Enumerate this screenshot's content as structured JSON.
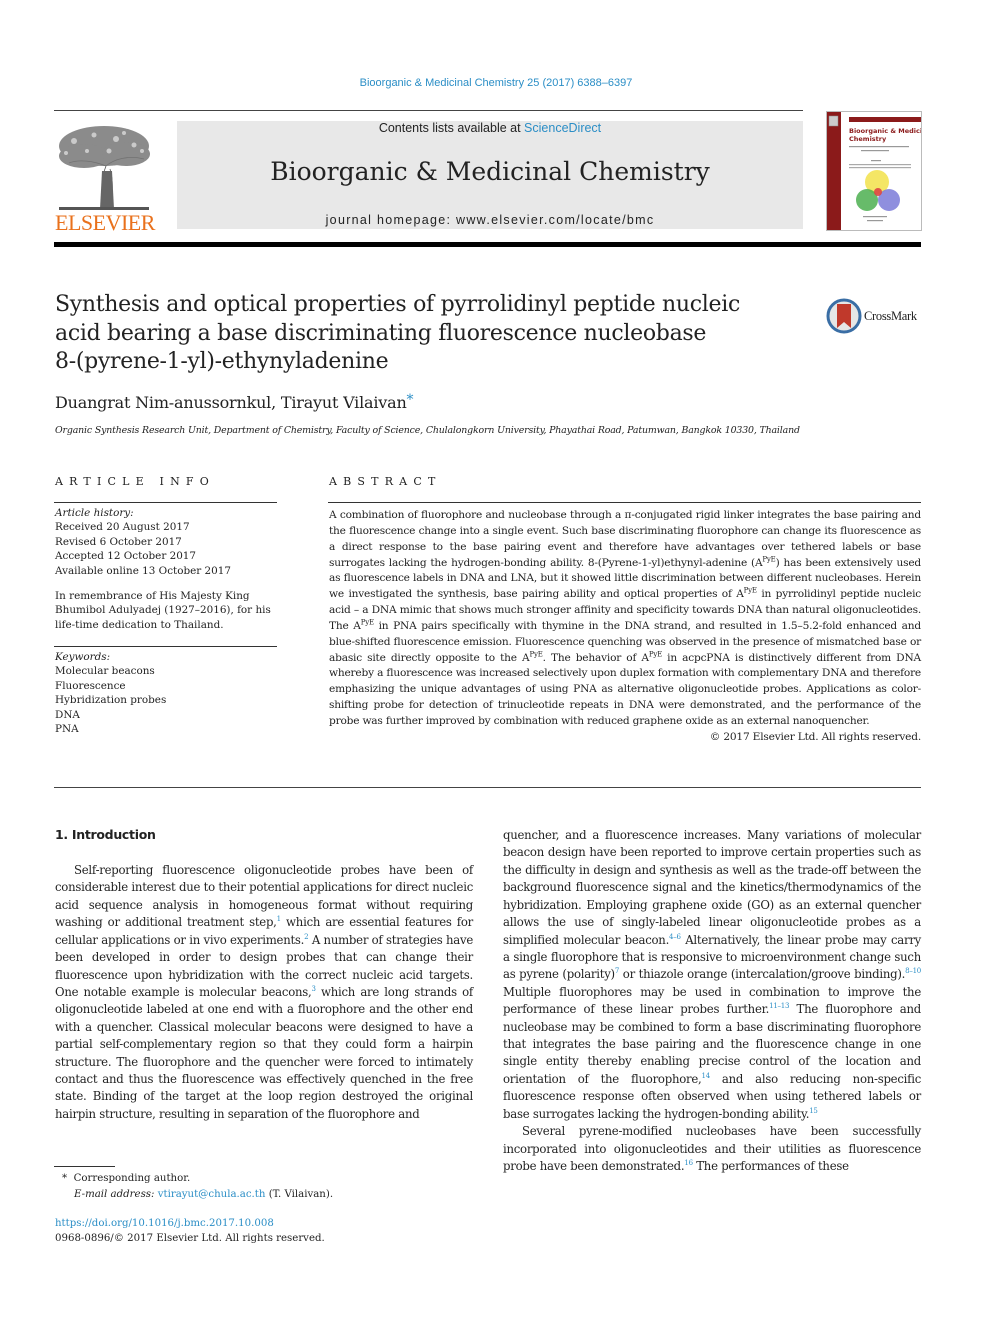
{
  "header": {
    "citation": "Bioorganic & Medicinal Chemistry 25 (2017) 6388–6397",
    "contents_prefix": "Contents lists available at ",
    "contents_link": "ScienceDirect",
    "journal_title": "Bioorganic & Medicinal Chemistry",
    "homepage": "journal homepage: www.elsevier.com/locate/bmc",
    "publisher_logo_text": "ELSEVIER",
    "cover_title": "Bioorganic & Medicinal Chemistry",
    "crossmark_label": "CrossMark"
  },
  "colors": {
    "link": "#2b8ec6",
    "elsevier_orange": "#e9711c",
    "cover_red": "#8b1a1a"
  },
  "article": {
    "title_lines": [
      "Synthesis and optical properties of pyrrolidinyl peptide nucleic",
      "acid bearing a base discriminating fluorescence nucleobase",
      "8-(pyrene-1-yl)-ethynyladenine"
    ],
    "authors": "Duangrat Nim-anussornkul, Tirayut Vilaivan",
    "corresponding_mark": "*",
    "affiliation": "Organic Synthesis Research Unit, Department of Chemistry, Faculty of Science, Chulalongkorn University, Phayathai Road, Patumwan, Bangkok 10330, Thailand"
  },
  "article_info": {
    "heading": "ARTICLE INFO",
    "history_label": "Article history:",
    "history": [
      "Received 20 August 2017",
      "Revised 6 October 2017",
      "Accepted 12 October 2017",
      "Available online 13 October 2017"
    ],
    "dedication_lines": [
      "In remembrance of His Majesty King",
      "Bhumibol Adulyadej (1927–2016), for his",
      "life-time dedication to Thailand."
    ],
    "keywords_label": "Keywords:",
    "keywords": [
      "Molecular beacons",
      "Fluorescence",
      "Hybridization probes",
      "DNA",
      "PNA"
    ]
  },
  "abstract": {
    "heading": "ABSTRACT",
    "segments": [
      "A combination of fluorophore and nucleobase through a π-conjugated rigid linker integrates the base pairing and the fluorescence change into a single event. Such base discriminating fluorophore can change its fluorescence as a direct response to the base pairing event and therefore have advantages over tethered labels or base surrogates lacking the hydrogen-bonding ability. 8-(Pyrene-1-yl)ethynyl-adenine (A",
      ") has been extensively used as fluorescence labels in DNA and LNA, but it showed little discrimination between different nucleobases. Herein we investigated the synthesis, base pairing ability and optical properties of A",
      " in pyrrolidinyl peptide nucleic acid – a DNA mimic that shows much stronger affinity and specificity towards DNA than natural oligonucleotides. The A",
      " in PNA pairs specifically with thymine in the DNA strand, and resulted in 1.5–5.2-fold enhanced and blue-shifted fluorescence emission. Fluorescence quenching was observed in the presence of mismatched base or abasic site directly opposite to the A",
      ". The behavior of A",
      " in acpcPNA is distinctively different from DNA whereby a fluorescence was increased selectively upon duplex formation with complementary DNA and therefore emphasizing the unique advantages of using PNA as alternative oligonucleotide probes. Applications as color-shifting probe for detection of trinucleotide repeats in DNA were demonstrated, and the performance of the probe was further improved by combination with reduced graphene oxide as an external nanoquencher."
    ],
    "superscript": "PyE",
    "copyright": "© 2017 Elsevier Ltd. All rights reserved."
  },
  "introduction": {
    "heading": "1. Introduction",
    "left": {
      "p1": [
        "Self-reporting fluorescence oligonucleotide probes have been of considerable interest due to their potential applications for direct nucleic acid sequence analysis in homogeneous format without requiring washing or additional treatment step,",
        " which are essential features for cellular applications or in vivo experiments.",
        " A number of strategies have been developed in order to design probes that can change their fluorescence upon hybridization with the correct nucleic acid targets. One notable example is molecular beacons,",
        " which are long strands of oligonucleotide labeled at one end with a fluorophore and the other end with a quencher. Classical molecular beacons were designed to have a partial self-complementary region so that they could form a hairpin structure. The fluorophore and the quencher were forced to intimately contact and thus the fluorescence was effectively quenched in the free state. Binding of the target at the loop region destroyed the original hairpin structure, resulting in separation of the fluorophore and"
      ],
      "refs": [
        "1",
        "2",
        "3"
      ]
    },
    "right": {
      "p1": [
        "quencher, and a fluorescence increases. Many variations of molecular beacon design have been reported to improve certain properties such as the difficulty in design and synthesis as well as the trade-off between the background fluorescence signal and the kinetics/thermodynamics of the hybridization. Employing graphene oxide (GO) as an external quencher allows the use of singly-labeled linear oligonucleotide probes as a simplified molecular beacon.",
        " Alternatively, the linear probe may carry a single fluorophore that is responsive to microenvironment change such as pyrene (polarity)",
        " or thiazole orange (intercalation/groove binding).",
        " Multiple fluorophores may be used in combination to improve the performance of these linear probes further.",
        " The fluorophore and nucleobase may be combined to form a base discriminating fluorophore that integrates the base pairing and the fluorescence change in one single entity thereby enabling precise control of the location and orientation of the fluorophore,",
        " and also reducing non-specific fluorescence response often observed when using tethered labels or base surrogates lacking the hydrogen-bonding ability."
      ],
      "refs": [
        "4–6",
        "7",
        "8–10",
        "11–13",
        "14",
        "15"
      ],
      "p2": [
        "Several pyrene-modified nucleobases have been successfully incorporated into oligonucleotides and their utilities as fluorescence probe have been demonstrated.",
        " The performances of these"
      ],
      "p2_refs": [
        "16"
      ]
    }
  },
  "footnotes": {
    "star": "*",
    "corresponding": "Corresponding author.",
    "email_label": "E-mail address:",
    "email": "vtirayut@chula.ac.th",
    "email_suffix": " (T. Vilaivan).",
    "doi": "https://doi.org/10.1016/j.bmc.2017.10.008",
    "issn": "0968-0896/© 2017 Elsevier Ltd. All rights reserved."
  }
}
